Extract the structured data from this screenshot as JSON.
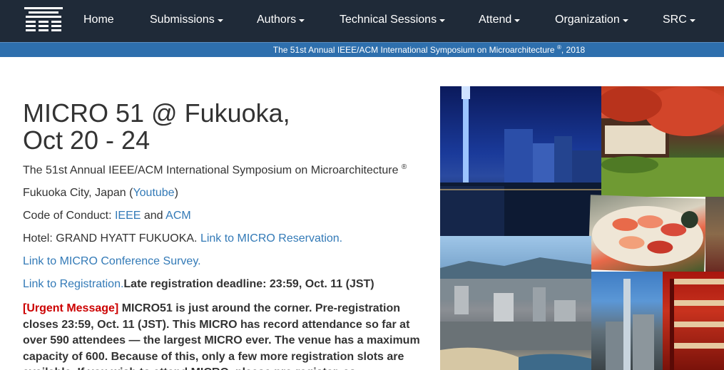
{
  "navbar": {
    "logo_icon": "pagoda-logo-icon",
    "items": [
      {
        "label": "Home",
        "dropdown": false
      },
      {
        "label": "Submissions",
        "dropdown": true
      },
      {
        "label": "Authors",
        "dropdown": true
      },
      {
        "label": "Technical Sessions",
        "dropdown": true
      },
      {
        "label": "Attend",
        "dropdown": true
      },
      {
        "label": "Organization",
        "dropdown": true
      },
      {
        "label": "SRC",
        "dropdown": true
      }
    ]
  },
  "banner": {
    "text": "The 51st Annual IEEE/ACM International Symposium on Microarchitecture",
    "registered": "®",
    "year": ", 2018"
  },
  "main": {
    "title_line1": "MICRO 51 @ Fukuoka,",
    "title_line2": "Oct 20 - 24",
    "subtitle": "The 51st Annual IEEE/ACM International Symposium on Microarchitecture",
    "subtitle_mark": "®",
    "location_text": "Fukuoka City, Japan (",
    "location_link": "Youtube",
    "location_close": ")",
    "conduct_text": "Code of Conduct: ",
    "conduct_link1": "IEEE",
    "conduct_and": " and ",
    "conduct_link2": "ACM",
    "hotel_text": "Hotel: GRAND HYATT FUKUOKA. ",
    "hotel_link": "Link to MICRO Reservation.",
    "survey_link": "Link to MICRO Conference Survey.",
    "registration_link": "Link to Registration.",
    "registration_deadline": "Late registration deadline: 23:59, Oct. 11 (JST)",
    "urgent_tag": "[Urgent Message]",
    "urgent_body": " MICRO51 is just around the corner. Pre-registration closes 23:59, Oct. 11 (JST). This MICRO has record attendance so far at over 590 attendees — the largest MICRO ever. The venue has a maximum capacity of 600. Because of this, only a few more registration slots are available. If you wish to attend MICRO, please pre-register, as"
  },
  "colors": {
    "navbar_bg": "#1f2a38",
    "banner_bg": "#2e6fad",
    "link": "#337ab7",
    "urgent": "#cc0000"
  }
}
